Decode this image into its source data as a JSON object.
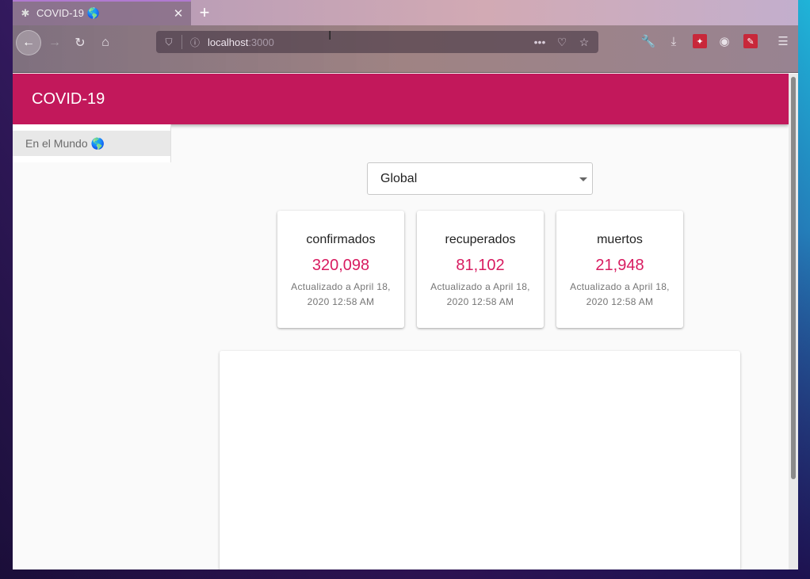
{
  "browser": {
    "tab_title": "COVID-19 🌎",
    "url_host": "localhost",
    "url_port": ":3000"
  },
  "app": {
    "title": "COVID-19",
    "accent_color": "#c2185b",
    "value_color": "#d81b60"
  },
  "sidebar": {
    "items": [
      {
        "label": "En el Mundo 🌎"
      }
    ]
  },
  "region_select": {
    "value": "Global"
  },
  "stats": [
    {
      "label": "confirmados",
      "value": "320,098",
      "updated": "Actualizado a April 18, 2020 12:58 AM"
    },
    {
      "label": "recuperados",
      "value": "81,102",
      "updated": "Actualizado a April 18, 2020 12:58 AM"
    },
    {
      "label": "muertos",
      "value": "21,948",
      "updated": "Actualizado a April 18, 2020 12:58 AM"
    }
  ]
}
